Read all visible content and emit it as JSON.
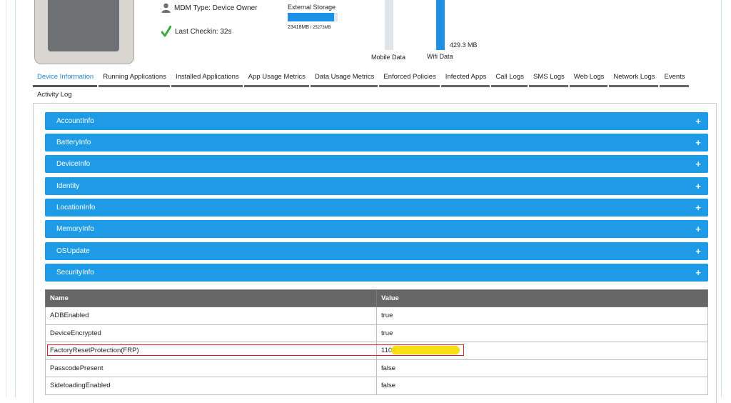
{
  "device": {
    "mdm_type": "MDM Type: Device Owner",
    "last_checkin": "Last Checkin: 32s",
    "storage_title": "External Storage",
    "storage_used": "23418MB",
    "storage_total": "25273MB",
    "storage_fraction": 0.926
  },
  "data_chart": {
    "mobile_label": "Mobile Data",
    "wifi_label": "Wifi Data",
    "wifi_value": "429.3 MB",
    "accent": "#1e90e6"
  },
  "tabs": [
    "Device Information",
    "Running Applications",
    "Installed Applications",
    "App Usage Metrics",
    "Data Usage Metrics",
    "Enforced Policies",
    "Infected Apps",
    "Call Logs",
    "SMS Logs",
    "Web Logs",
    "Network Logs",
    "Events",
    "Activity Log"
  ],
  "active_tab": "Device Information",
  "accordion": [
    "AccountInfo",
    "BatteryInfo",
    "DeviceInfo",
    "Identity",
    "LocationInfo",
    "MemoryInfo",
    "OSUpdate",
    "SecurityInfo"
  ],
  "accordion_color": "#1e9be6",
  "table": {
    "headers": {
      "name": "Name",
      "value": "Value"
    },
    "rows": [
      {
        "name": "ADBEnabled",
        "value": "true"
      },
      {
        "name": "DeviceEncrypted",
        "value": "true"
      },
      {
        "name": "FactoryResetProtection(FRP)",
        "value": "1109"
      },
      {
        "name": "PasscodePresent",
        "value": "false"
      },
      {
        "name": "SideloadingEnabled",
        "value": "false"
      }
    ]
  },
  "highlight_color": "#d9242b"
}
